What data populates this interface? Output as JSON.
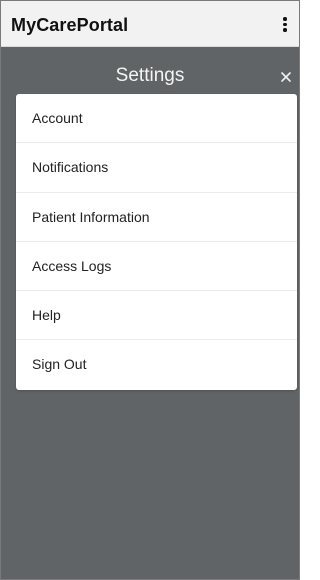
{
  "app": {
    "title": "MyCarePortal"
  },
  "overlay": {
    "title": "Settings",
    "close_icon": "close-icon"
  },
  "menu": {
    "items": [
      {
        "label": "Account"
      },
      {
        "label": "Notifications"
      },
      {
        "label": "Patient Information"
      },
      {
        "label": "Access Logs"
      },
      {
        "label": "Help"
      },
      {
        "label": "Sign Out"
      }
    ]
  },
  "colors": {
    "appbar_bg": "#f2f2f2",
    "overlay_bg": "#616466",
    "card_bg": "#ffffff",
    "text_dark": "#222222",
    "text_light": "#f4f4f4"
  }
}
